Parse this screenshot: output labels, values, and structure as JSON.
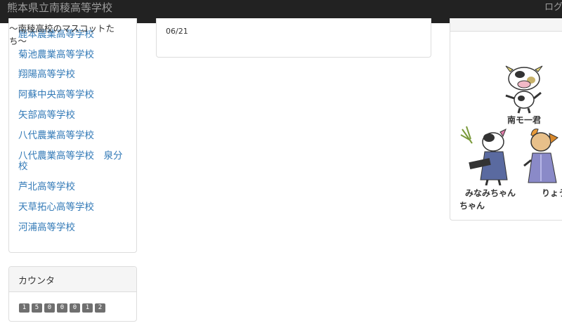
{
  "header": {
    "title": "熊本県立南稜高等学校",
    "login_label": "ログ"
  },
  "links": [
    "鹿本農業高等学校",
    "菊池農業高等学校",
    "翔陽高等学校",
    "阿蘇中央高等学校",
    "矢部高等学校",
    "八代農業高等学校",
    "八代農業高等学校　泉分",
    "校",
    "芦北高等学校",
    "天草拓心高等学校",
    "河浦高等学校"
  ],
  "counter": {
    "title": "カウンタ",
    "digits": [
      "1",
      "5",
      "0",
      "0",
      "0",
      "1",
      "2"
    ]
  },
  "news": {
    "date": "06/21"
  },
  "mascots": {
    "title": "～南稜高校のマスコットたち～",
    "label_1": "南モ一君",
    "label_2": "みなみちゃん",
    "label_3": "りょう",
    "label_4": "ちゃん"
  },
  "colors": {
    "navbar": "#222222",
    "link": "#337ab7",
    "counter_digit_bg": "#6f6f6f"
  }
}
